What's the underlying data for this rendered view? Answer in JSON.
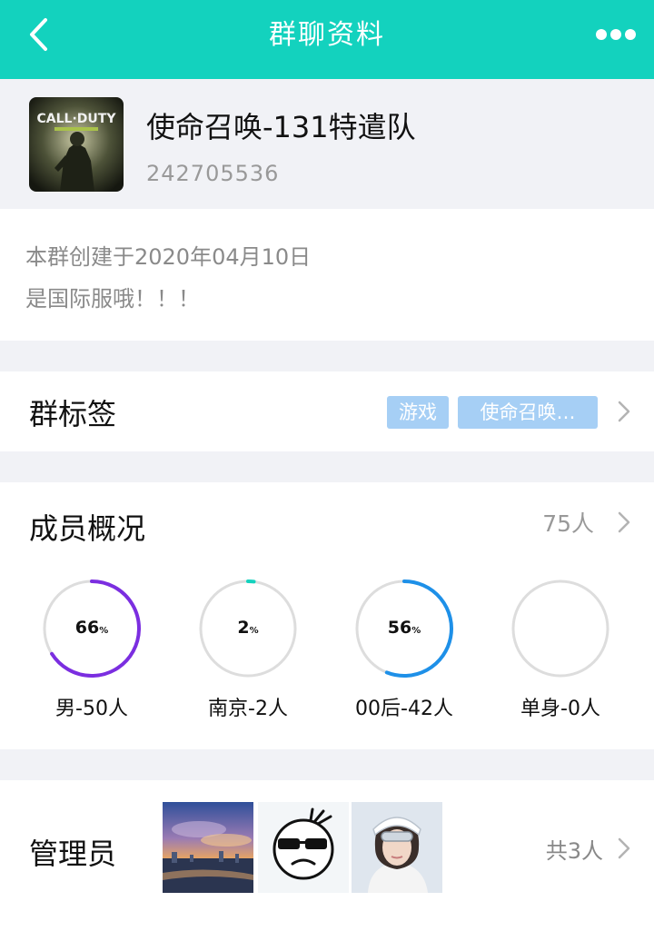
{
  "header": {
    "title": "群聊资料",
    "back_icon": "chevron-left-icon",
    "more_icon": "more-dots-icon",
    "bg_color": "#13d2be"
  },
  "group": {
    "name": "使命召唤-131特遣队",
    "id": "242705536",
    "avatar_text": "CALL DUTY"
  },
  "intro": {
    "line1": "本群创建于2020年04月10日",
    "line2": "是国际服哦！！！"
  },
  "tags": {
    "label": "群标签",
    "items": [
      "游戏",
      "使命召唤…"
    ]
  },
  "members": {
    "label": "成员概况",
    "count": "75人",
    "stats": [
      {
        "percent": 66,
        "percent_text": "66",
        "pct_sign": "%",
        "label": "男-50人",
        "color": "#7b2ee0"
      },
      {
        "percent": 2,
        "percent_text": "2",
        "pct_sign": "%",
        "label": "南京-2人",
        "color": "#13d2be"
      },
      {
        "percent": 56,
        "percent_text": "56",
        "pct_sign": "%",
        "label": "00后-42人",
        "color": "#1e90e8"
      },
      {
        "percent": 0,
        "percent_text": "",
        "pct_sign": "",
        "label": "单身-0人",
        "color": "#dddddd"
      }
    ]
  },
  "admins": {
    "label": "管理员",
    "total": "共3人"
  }
}
